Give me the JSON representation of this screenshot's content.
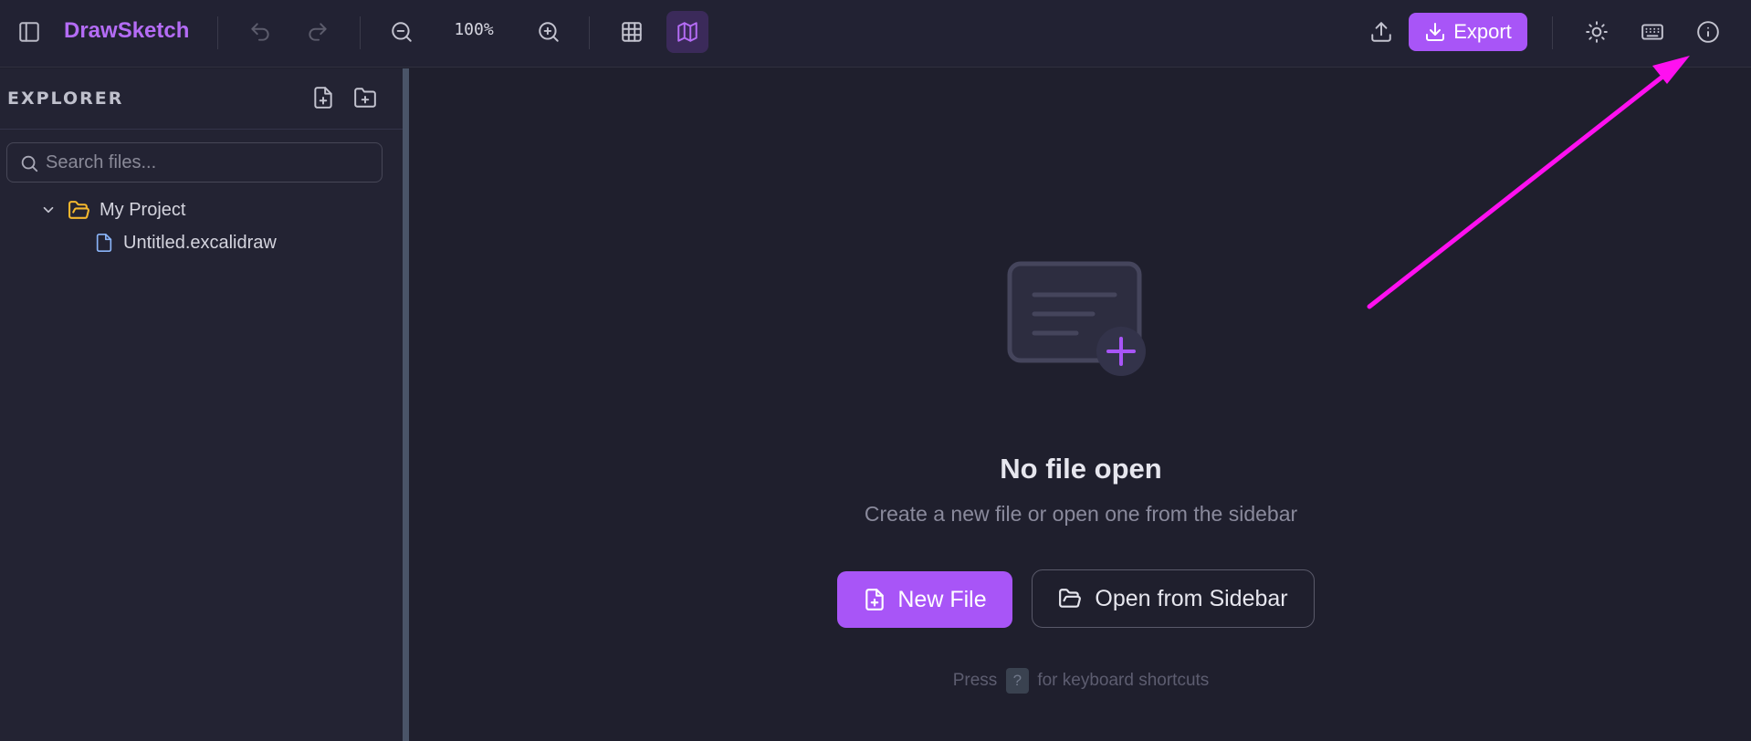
{
  "app": {
    "name": "DrawSketch"
  },
  "toolbar": {
    "zoom_level": "100%",
    "export_label": "Export",
    "icons": [
      "sidebar-toggle-icon",
      "undo-icon",
      "redo-icon",
      "zoom-out-icon",
      "zoom-in-icon",
      "grid-icon",
      "map-icon",
      "upload-icon",
      "download-icon",
      "sun-icon",
      "keyboard-icon",
      "info-icon"
    ]
  },
  "sidebar": {
    "title": "EXPLORER",
    "search_placeholder": "Search files...",
    "tree": [
      {
        "type": "folder",
        "label": "My Project",
        "expanded": true
      },
      {
        "type": "file",
        "label": "Untitled.excalidraw"
      }
    ]
  },
  "main": {
    "empty_title": "No file open",
    "empty_subtitle": "Create a new file or open one from the sidebar",
    "new_file_label": "New File",
    "open_sidebar_label": "Open from Sidebar",
    "hint_prefix": "Press",
    "hint_key": "?",
    "hint_suffix": "for keyboard shortcuts"
  },
  "colors": {
    "accent": "#a855f7",
    "background": "#1f1f2d",
    "folder": "#f5b82e",
    "file": "#8ab4f8",
    "annotation_arrow": "#ff10f0"
  }
}
